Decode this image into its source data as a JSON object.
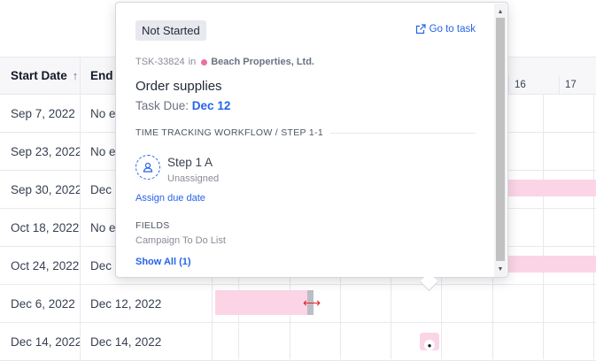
{
  "table": {
    "headers": {
      "start_date": "Start Date",
      "end_date": "End"
    },
    "rows": [
      {
        "start": "Sep 7, 2022",
        "end": "No e"
      },
      {
        "start": "Sep 23, 2022",
        "end": "No e"
      },
      {
        "start": "Sep 30, 2022",
        "end": "Dec"
      },
      {
        "start": "Oct 18, 2022",
        "end": "No e"
      },
      {
        "start": "Oct 24, 2022",
        "end": "Dec"
      },
      {
        "start": "Dec 6, 2022",
        "end": "Dec 12, 2022"
      },
      {
        "start": "Dec 14, 2022",
        "end": "Dec 14, 2022"
      }
    ]
  },
  "timeline": {
    "days": [
      "16",
      "17"
    ]
  },
  "colors": {
    "accent": "#2563eb",
    "bar": "#fbd5e5",
    "client_dot": "#ec6fa0",
    "handle": "#dc2626"
  },
  "popover": {
    "status": "Not Started",
    "goto_label": "Go to task",
    "task_id": "TSK-33824",
    "in_label": "in",
    "client": "Beach Properties, Ltd.",
    "title": "Order supplies",
    "due_label": "Task Due:",
    "due_value": "Dec 12",
    "workflow_label": "TIME TRACKING WORKFLOW / STEP 1-1",
    "step": {
      "name": "Step 1 A",
      "assignee": "Unassigned"
    },
    "assign_due_label": "Assign due date",
    "fields_label": "FIELDS",
    "field_item": "Campaign To Do List",
    "show_all_label": "Show All (1)"
  }
}
